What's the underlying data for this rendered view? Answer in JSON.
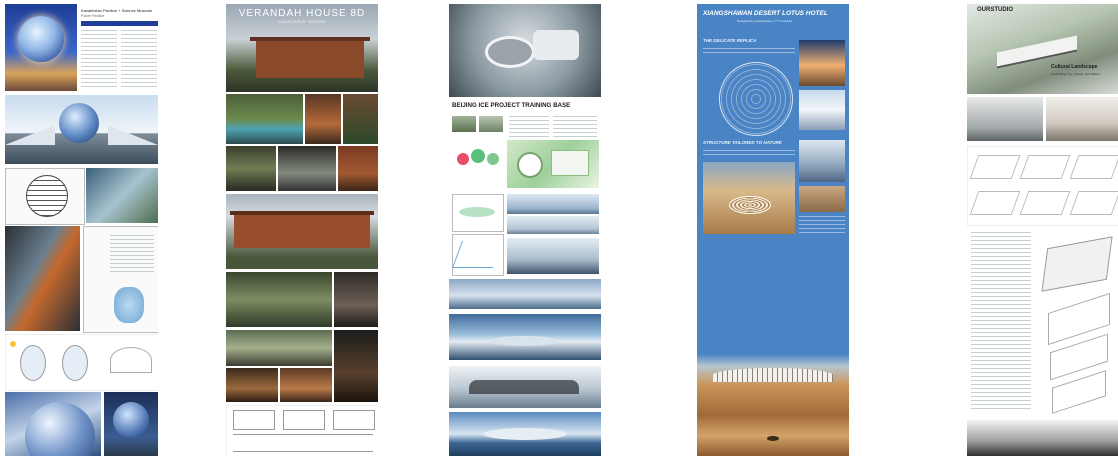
{
  "boards": [
    {
      "title": "Kazakhstan Pavilion + Science Museum",
      "subtitle": "Future Pavilion",
      "banner": "...",
      "colors": {
        "accent": "#1f3f96",
        "sky": "#2b53b8"
      }
    },
    {
      "title": "VERANDAH HOUSE 8D",
      "subtitle": "KUALA LUMPUR · MALAYSIA",
      "colors": {
        "accent": "#8a4a2a"
      }
    },
    {
      "title": "BEIJING ICE PROJECT TRAINING BASE",
      "colors": {
        "accent": "#1c1c1c",
        "sea": "#2d5f8d"
      }
    },
    {
      "title": "XIANGSHAWAN DESERT LOTUS HOTEL",
      "subtitle": "Designed by Headquarters, YYYY-HHHH",
      "section1": "THE DELICATE REPLICA",
      "section2": "STRUCTURE TAILORED TO NATURE",
      "colors": {
        "panel": "#4a84c4",
        "sand": "#c9965a"
      }
    },
    {
      "title": "OURSTUDIO",
      "heading": "Cultural Landscape",
      "tagline": "Connecting City, Culture, and Nature",
      "colors": {
        "accent": "#222222"
      }
    }
  ]
}
